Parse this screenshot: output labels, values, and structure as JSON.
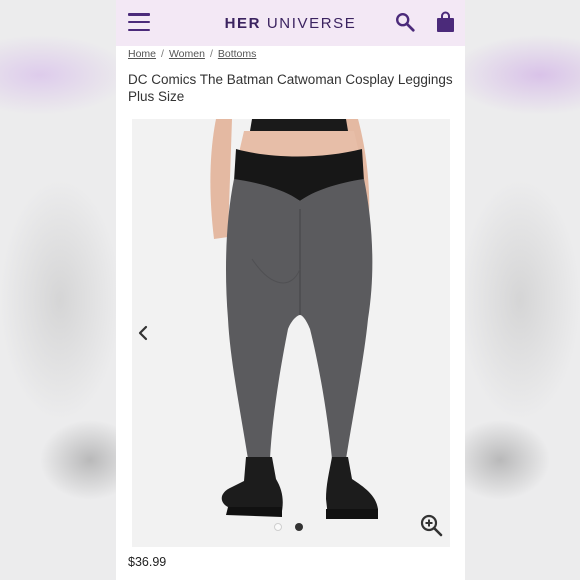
{
  "header": {
    "logo_bold": "HER",
    "logo_rest": "UNIVERSE",
    "brand_color": "#3b2360",
    "bar_color": "#f3e8f5",
    "icons": [
      "hamburger-menu-icon",
      "search-icon",
      "shopping-bag-icon"
    ]
  },
  "breadcrumb": {
    "items": [
      {
        "label": "Home"
      },
      {
        "label": "Women"
      },
      {
        "label": "Bottoms"
      }
    ],
    "separator": "/"
  },
  "product": {
    "title": "DC Comics The Batman Catwoman Cosplay Leggings Plus Size",
    "price": "$36.99"
  },
  "gallery": {
    "image_count": 2,
    "active_index": 1,
    "icons": [
      "chevron-left-icon",
      "zoom-in-icon"
    ]
  }
}
